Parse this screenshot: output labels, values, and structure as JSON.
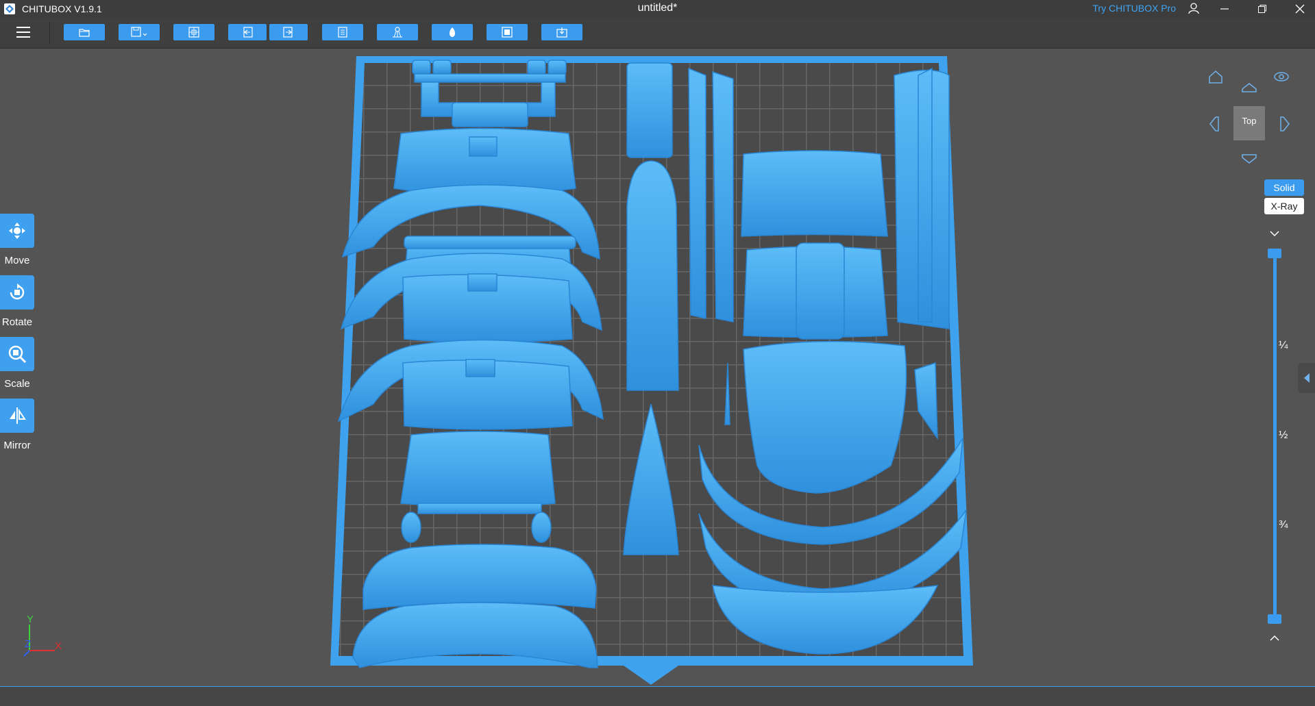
{
  "app": {
    "name": "CHITUBOX V1.9.1",
    "document_title": "untitled*",
    "pro_link": "Try CHITUBOX Pro"
  },
  "tools": [
    {
      "id": "move",
      "label": "Move"
    },
    {
      "id": "rotate",
      "label": "Rotate"
    },
    {
      "id": "scale",
      "label": "Scale"
    },
    {
      "id": "mirror",
      "label": "Mirror"
    }
  ],
  "view": {
    "current": "Top",
    "modes": {
      "solid": "Solid",
      "xray": "X-Ray"
    },
    "fractions": [
      "¼",
      "½",
      "¾"
    ]
  },
  "axes": {
    "y": "Y",
    "z": "Z",
    "x": "X"
  },
  "colors": {
    "accent": "#3a9bef",
    "model": "#46a8ef",
    "plate": "#4a4a4a",
    "grid": "#5e5e5e"
  },
  "icons": [
    "menu-icon",
    "open-icon",
    "save-icon",
    "center-icon",
    "undo-icon",
    "redo-icon",
    "layout-icon",
    "support-icon",
    "hollow-icon",
    "slice-icon",
    "export-icon",
    "user-icon",
    "home-view-icon",
    "eye-icon"
  ]
}
